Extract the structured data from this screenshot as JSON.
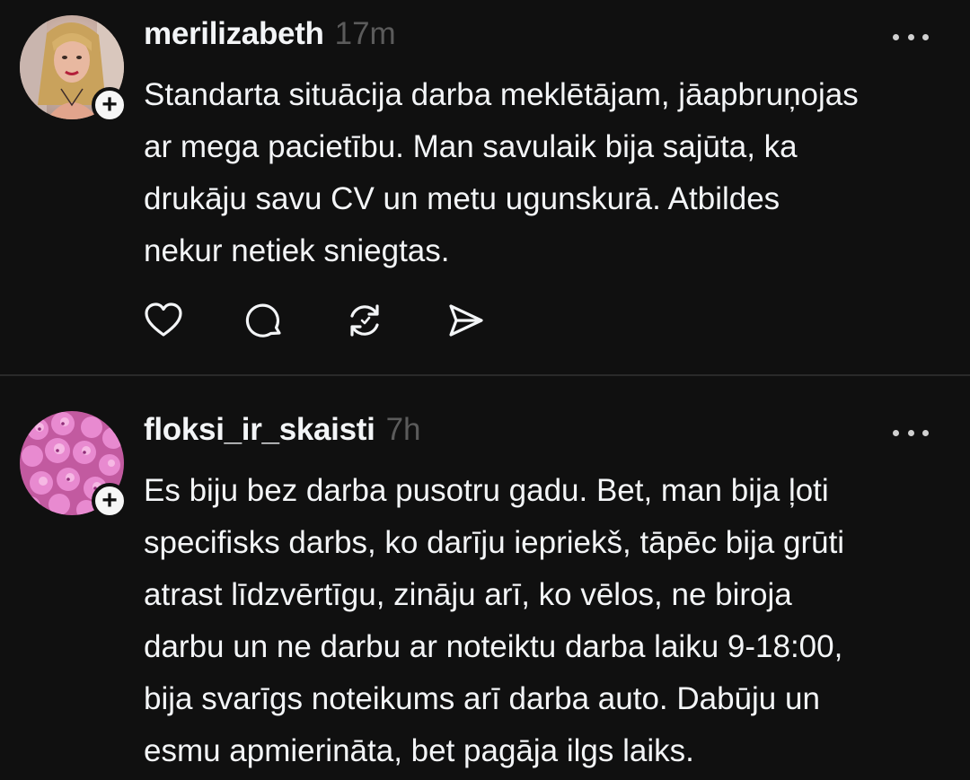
{
  "posts": [
    {
      "username": "merilizabeth",
      "time": "17m",
      "text": "Standarta situācija darba meklētājam, jāapbruņojas\nar mega pacietību. Man savulaik bija sajūta, ka\ndrukāju savu CV un metu ugunskurā. Atbildes\nnekur netiek sniegtas.",
      "actions": [
        "heart-icon",
        "comment-icon",
        "repost-icon",
        "share-icon"
      ]
    },
    {
      "username": "floksi_ir_skaisti",
      "time": "7h",
      "text": "Es biju bez darba pusotru gadu. Bet, man bija ļoti\nspecifisks darbs, ko darīju iepriekš, tāpēc bija grūti\natrast līdzvērtīgu, zināju arī, ko vēlos, ne biroja\ndarbu un ne darbu ar noteiktu darba laiku 9-18:00,\nbija svarīgs noteikums arī darba auto. Dabūju un\nesmu apmierināta, bet pagāja ilgs laiks."
    }
  ],
  "follow_badge": "+",
  "colors": {
    "background": "#101010",
    "text": "#f3f5f7",
    "muted": "#5b5b5b",
    "divider": "#2a2a2a"
  }
}
